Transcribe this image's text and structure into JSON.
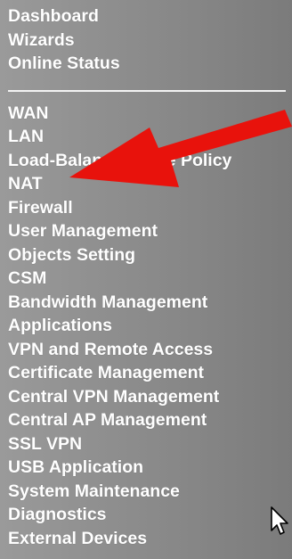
{
  "menu": {
    "top_items": [
      {
        "label": "Dashboard"
      },
      {
        "label": "Wizards"
      },
      {
        "label": "Online Status"
      }
    ],
    "main_items": [
      {
        "label": "WAN"
      },
      {
        "label": "LAN"
      },
      {
        "label": "Load-Balance/Route Policy"
      },
      {
        "label": "NAT"
      },
      {
        "label": "Firewall"
      },
      {
        "label": "User Management"
      },
      {
        "label": "Objects Setting"
      },
      {
        "label": "CSM"
      },
      {
        "label": "Bandwidth Management"
      },
      {
        "label": "Applications"
      },
      {
        "label": "VPN and Remote Access"
      },
      {
        "label": "Certificate Management"
      },
      {
        "label": "Central VPN Management"
      },
      {
        "label": "Central AP Management"
      },
      {
        "label": "SSL VPN"
      },
      {
        "label": "USB Application"
      },
      {
        "label": "System Maintenance"
      },
      {
        "label": "Diagnostics"
      },
      {
        "label": "External Devices"
      }
    ]
  },
  "colors": {
    "menu_text": "#ffffff",
    "arrow": "#e8120c",
    "divider": "#f3f3f3"
  },
  "icons": {
    "annotation": "red-arrow-icon",
    "pointer": "mouse-cursor-icon"
  }
}
